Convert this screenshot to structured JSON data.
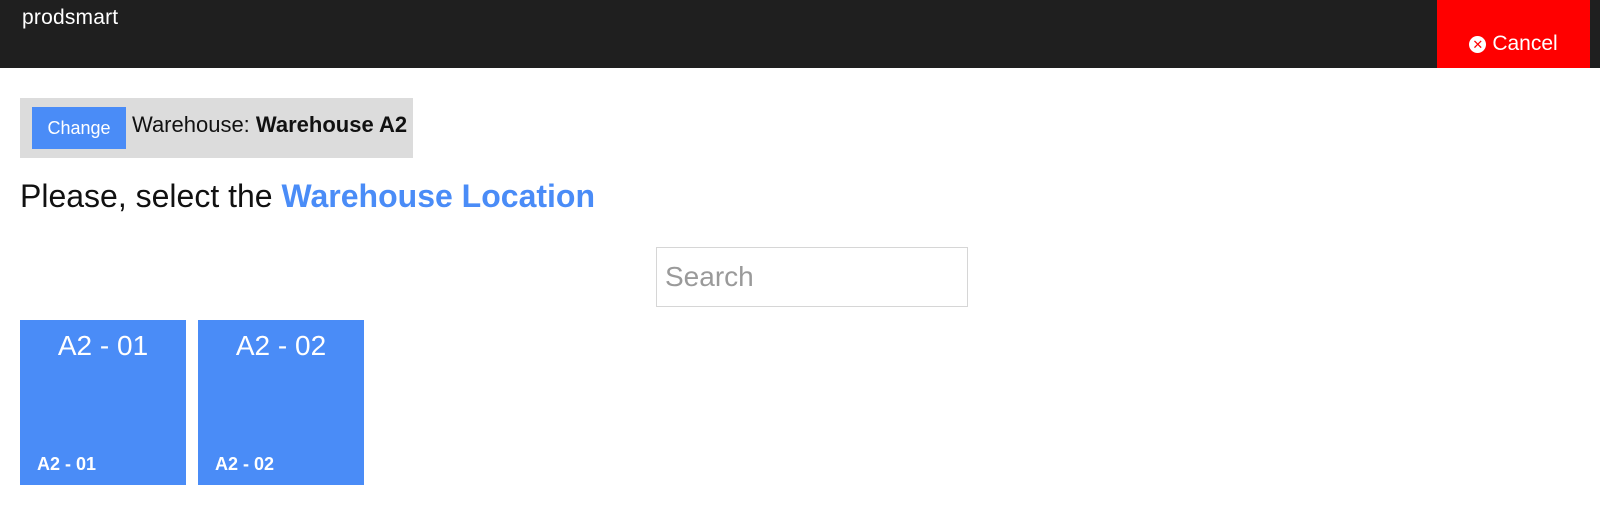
{
  "header": {
    "brand": "prodsmart",
    "cancel_label": "Cancel"
  },
  "warehouse_bar": {
    "change_label": "Change",
    "warehouse_prefix": "Warehouse: ",
    "warehouse_name": "Warehouse A2"
  },
  "prompt": {
    "text": "Please, select the ",
    "highlight": "Warehouse Location"
  },
  "search": {
    "placeholder": "Search",
    "value": ""
  },
  "locations": [
    {
      "title": "A2 - 01",
      "code": "A2 - 01"
    },
    {
      "title": "A2 - 02",
      "code": "A2 - 02"
    }
  ],
  "colors": {
    "header_bg": "#1f1f1f",
    "cancel_bg": "#ff0000",
    "accent": "#4a8cf7",
    "warehouse_bar_bg": "#dcdcdc"
  },
  "icons": {
    "cancel": "times-circle-icon"
  }
}
